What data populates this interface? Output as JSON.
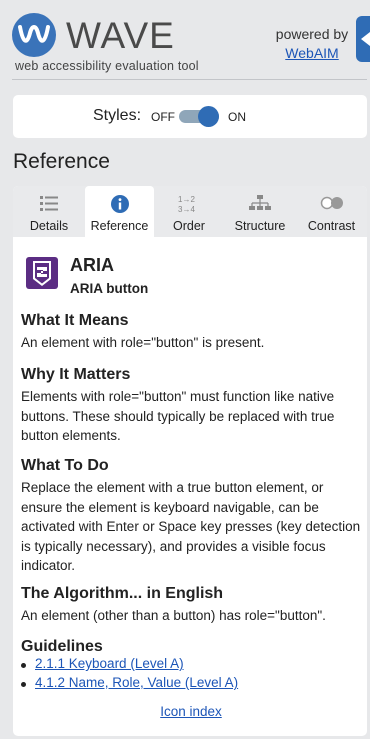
{
  "header": {
    "title": "WAVE",
    "subtitle": "web accessibility evaluation tool",
    "powered_by": "powered by",
    "webaim_link": "WebAIM",
    "brand_color": "#3a73b9"
  },
  "styles_toggle": {
    "label": "Styles:",
    "off": "OFF",
    "on": "ON",
    "state": "on"
  },
  "section_title": "Reference",
  "tabs": [
    {
      "label": "Details",
      "icon": "list-icon",
      "active": false
    },
    {
      "label": "Reference",
      "icon": "info-icon",
      "active": true
    },
    {
      "label": "Order",
      "icon": "order-icon",
      "active": false
    },
    {
      "label": "Structure",
      "icon": "structure-icon",
      "active": false
    },
    {
      "label": "Contrast",
      "icon": "contrast-icon",
      "active": false
    }
  ],
  "reference": {
    "category": "ARIA",
    "item": "ARIA button",
    "icon_color": "#5b2d83",
    "what_it_means_title": "What It Means",
    "what_it_means": "An element with role=\"button\" is present.",
    "why_title": "Why It Matters",
    "why": "Elements with role=\"button\" must function like native buttons. These should typically be replaced with true button elements.",
    "todo_title": "What To Do",
    "todo": "Replace the element with a true button element, or ensure the element is keyboard navigable, can be activated with Enter or Space key presses (key detection is typically necessary), and provides a visible focus indicator.",
    "algo_title": "The Algorithm... in English",
    "algo": "An element (other than a button) has role=\"button\".",
    "guidelines_title": "Guidelines",
    "guidelines": [
      "2.1.1 Keyboard (Level A)",
      "4.1.2 Name, Role, Value (Level A)"
    ],
    "icon_index": "Icon index"
  }
}
